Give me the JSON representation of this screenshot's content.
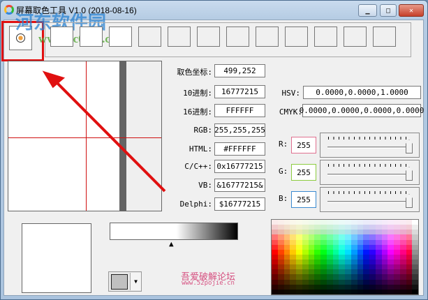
{
  "window": {
    "title": "屏幕取色工具 V1.0    (2018-08-16)",
    "minimize": "▁",
    "maximize": "□",
    "close": "✕"
  },
  "watermark": {
    "site_name": "河东软件园",
    "site_url": "www.pc0359.cn",
    "forum_name": "吾爱破解论坛",
    "forum_url": "www.52pojie.cn"
  },
  "fields": {
    "coord": {
      "label": "取色坐标:",
      "value": "499,252"
    },
    "dec": {
      "label": "10进制:",
      "value": "16777215"
    },
    "hex": {
      "label": "16进制:",
      "value": "FFFFFF"
    },
    "rgb": {
      "label": "RGB:",
      "value": "255,255,255"
    },
    "html": {
      "label": "HTML:",
      "value": "#FFFFFF"
    },
    "cpp": {
      "label": "C/C++:",
      "value": "0x16777215"
    },
    "vb": {
      "label": "VB:",
      "value": "&16777215&"
    },
    "delphi": {
      "label": "Delphi:",
      "value": "$16777215"
    },
    "hsv": {
      "label": "HSV:",
      "value": "0.0000,0.0000,1.0000"
    },
    "cmyk": {
      "label": "CMYK:",
      "value": "0.0000,0.0000,0.0000,0.0000"
    }
  },
  "channels": {
    "r": {
      "label": "R:",
      "value": "255",
      "color": "#e07090",
      "level": 1.0
    },
    "g": {
      "label": "G:",
      "value": "255",
      "color": "#8ccc40",
      "level": 1.0
    },
    "b": {
      "label": "B:",
      "value": "255",
      "color": "#3a8ad0",
      "level": 1.0
    }
  },
  "current_color": "#FFFFFF",
  "dropdown_color": "#C0C0C0",
  "dropdown_arrow": "▼",
  "brightness_marker": "▲"
}
